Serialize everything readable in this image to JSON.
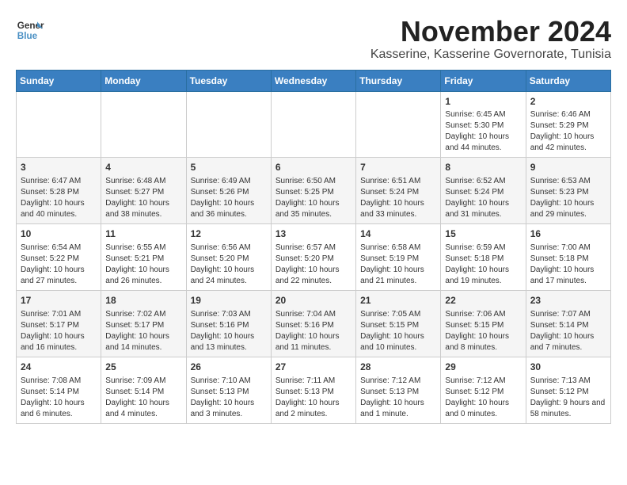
{
  "logo": {
    "line1": "General",
    "line2": "Blue"
  },
  "title": "November 2024",
  "location": "Kasserine, Kasserine Governorate, Tunisia",
  "weekdays": [
    "Sunday",
    "Monday",
    "Tuesday",
    "Wednesday",
    "Thursday",
    "Friday",
    "Saturday"
  ],
  "weeks": [
    [
      {
        "day": "",
        "info": ""
      },
      {
        "day": "",
        "info": ""
      },
      {
        "day": "",
        "info": ""
      },
      {
        "day": "",
        "info": ""
      },
      {
        "day": "",
        "info": ""
      },
      {
        "day": "1",
        "info": "Sunrise: 6:45 AM\nSunset: 5:30 PM\nDaylight: 10 hours and 44 minutes."
      },
      {
        "day": "2",
        "info": "Sunrise: 6:46 AM\nSunset: 5:29 PM\nDaylight: 10 hours and 42 minutes."
      }
    ],
    [
      {
        "day": "3",
        "info": "Sunrise: 6:47 AM\nSunset: 5:28 PM\nDaylight: 10 hours and 40 minutes."
      },
      {
        "day": "4",
        "info": "Sunrise: 6:48 AM\nSunset: 5:27 PM\nDaylight: 10 hours and 38 minutes."
      },
      {
        "day": "5",
        "info": "Sunrise: 6:49 AM\nSunset: 5:26 PM\nDaylight: 10 hours and 36 minutes."
      },
      {
        "day": "6",
        "info": "Sunrise: 6:50 AM\nSunset: 5:25 PM\nDaylight: 10 hours and 35 minutes."
      },
      {
        "day": "7",
        "info": "Sunrise: 6:51 AM\nSunset: 5:24 PM\nDaylight: 10 hours and 33 minutes."
      },
      {
        "day": "8",
        "info": "Sunrise: 6:52 AM\nSunset: 5:24 PM\nDaylight: 10 hours and 31 minutes."
      },
      {
        "day": "9",
        "info": "Sunrise: 6:53 AM\nSunset: 5:23 PM\nDaylight: 10 hours and 29 minutes."
      }
    ],
    [
      {
        "day": "10",
        "info": "Sunrise: 6:54 AM\nSunset: 5:22 PM\nDaylight: 10 hours and 27 minutes."
      },
      {
        "day": "11",
        "info": "Sunrise: 6:55 AM\nSunset: 5:21 PM\nDaylight: 10 hours and 26 minutes."
      },
      {
        "day": "12",
        "info": "Sunrise: 6:56 AM\nSunset: 5:20 PM\nDaylight: 10 hours and 24 minutes."
      },
      {
        "day": "13",
        "info": "Sunrise: 6:57 AM\nSunset: 5:20 PM\nDaylight: 10 hours and 22 minutes."
      },
      {
        "day": "14",
        "info": "Sunrise: 6:58 AM\nSunset: 5:19 PM\nDaylight: 10 hours and 21 minutes."
      },
      {
        "day": "15",
        "info": "Sunrise: 6:59 AM\nSunset: 5:18 PM\nDaylight: 10 hours and 19 minutes."
      },
      {
        "day": "16",
        "info": "Sunrise: 7:00 AM\nSunset: 5:18 PM\nDaylight: 10 hours and 17 minutes."
      }
    ],
    [
      {
        "day": "17",
        "info": "Sunrise: 7:01 AM\nSunset: 5:17 PM\nDaylight: 10 hours and 16 minutes."
      },
      {
        "day": "18",
        "info": "Sunrise: 7:02 AM\nSunset: 5:17 PM\nDaylight: 10 hours and 14 minutes."
      },
      {
        "day": "19",
        "info": "Sunrise: 7:03 AM\nSunset: 5:16 PM\nDaylight: 10 hours and 13 minutes."
      },
      {
        "day": "20",
        "info": "Sunrise: 7:04 AM\nSunset: 5:16 PM\nDaylight: 10 hours and 11 minutes."
      },
      {
        "day": "21",
        "info": "Sunrise: 7:05 AM\nSunset: 5:15 PM\nDaylight: 10 hours and 10 minutes."
      },
      {
        "day": "22",
        "info": "Sunrise: 7:06 AM\nSunset: 5:15 PM\nDaylight: 10 hours and 8 minutes."
      },
      {
        "day": "23",
        "info": "Sunrise: 7:07 AM\nSunset: 5:14 PM\nDaylight: 10 hours and 7 minutes."
      }
    ],
    [
      {
        "day": "24",
        "info": "Sunrise: 7:08 AM\nSunset: 5:14 PM\nDaylight: 10 hours and 6 minutes."
      },
      {
        "day": "25",
        "info": "Sunrise: 7:09 AM\nSunset: 5:14 PM\nDaylight: 10 hours and 4 minutes."
      },
      {
        "day": "26",
        "info": "Sunrise: 7:10 AM\nSunset: 5:13 PM\nDaylight: 10 hours and 3 minutes."
      },
      {
        "day": "27",
        "info": "Sunrise: 7:11 AM\nSunset: 5:13 PM\nDaylight: 10 hours and 2 minutes."
      },
      {
        "day": "28",
        "info": "Sunrise: 7:12 AM\nSunset: 5:13 PM\nDaylight: 10 hours and 1 minute."
      },
      {
        "day": "29",
        "info": "Sunrise: 7:12 AM\nSunset: 5:12 PM\nDaylight: 10 hours and 0 minutes."
      },
      {
        "day": "30",
        "info": "Sunrise: 7:13 AM\nSunset: 5:12 PM\nDaylight: 9 hours and 58 minutes."
      }
    ]
  ]
}
